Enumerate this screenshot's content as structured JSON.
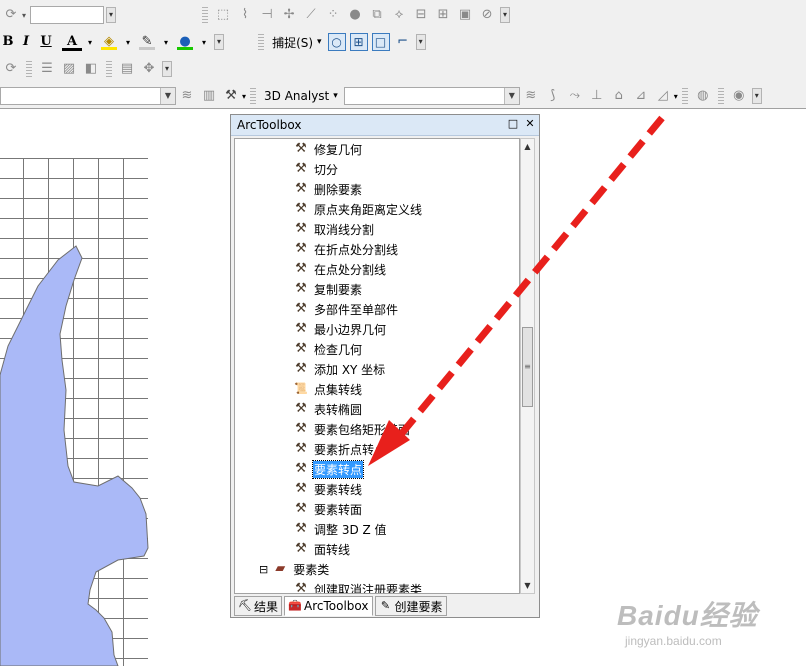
{
  "toolbar": {
    "snapping_label": "捕捉(S)",
    "snapping_arrow": "▾",
    "analyst_label": "3D Analyst",
    "analyst_arrow": "▾",
    "font_bold": "B",
    "font_italic": "I",
    "font_underline": "U",
    "font_color": "A"
  },
  "toolbox": {
    "title": "ArcToolbox",
    "restore_glyph": "□",
    "close_glyph": "✕",
    "items": [
      {
        "label": "修复几何",
        "icon": "hammer-icon"
      },
      {
        "label": "切分",
        "icon": "hammer-icon"
      },
      {
        "label": "删除要素",
        "icon": "hammer-icon"
      },
      {
        "label": "原点夹角距离定义线",
        "icon": "hammer-icon"
      },
      {
        "label": "取消线分割",
        "icon": "hammer-icon"
      },
      {
        "label": "在折点处分割线",
        "icon": "hammer-icon"
      },
      {
        "label": "在点处分割线",
        "icon": "hammer-icon"
      },
      {
        "label": "复制要素",
        "icon": "hammer-icon"
      },
      {
        "label": "多部件至单部件",
        "icon": "hammer-icon"
      },
      {
        "label": "最小边界几何",
        "icon": "hammer-icon"
      },
      {
        "label": "检查几何",
        "icon": "hammer-icon"
      },
      {
        "label": "添加 XY 坐标",
        "icon": "hammer-icon"
      },
      {
        "label": "点集转线",
        "icon": "script-icon"
      },
      {
        "label": "表转椭圆",
        "icon": "hammer-icon"
      },
      {
        "label": "要素包络矩形转面",
        "icon": "hammer-icon"
      },
      {
        "label": "要素折点转点",
        "icon": "hammer-icon"
      },
      {
        "label": "要素转点",
        "icon": "hammer-icon",
        "selected": true
      },
      {
        "label": "要素转线",
        "icon": "hammer-icon"
      },
      {
        "label": "要素转面",
        "icon": "hammer-icon"
      },
      {
        "label": "调整 3D Z 值",
        "icon": "hammer-icon"
      },
      {
        "label": "面转线",
        "icon": "hammer-icon"
      }
    ],
    "group": {
      "label": "要素类",
      "expander": "⊟"
    },
    "partial_item": "创建取消注册要素类",
    "tabs": [
      {
        "label": "结果",
        "icon": "results-icon"
      },
      {
        "label": "ArcToolbox",
        "icon": "toolbox-icon",
        "active": true
      },
      {
        "label": "创建要素",
        "icon": "create-features-icon"
      }
    ]
  },
  "watermark": {
    "brand": "Baidu经验",
    "url": "jingyan.baidu.com"
  },
  "colors": {
    "water": "#aab9f7",
    "selection": "#3399ff",
    "arrow": "#e8201c",
    "title_bar": "#dbe8f6"
  }
}
